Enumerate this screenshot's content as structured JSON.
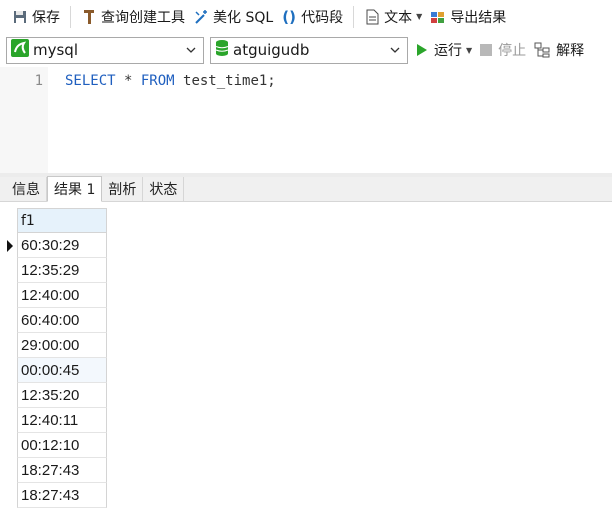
{
  "toolbar": {
    "save": "保存",
    "query_builder": "查询创建工具",
    "beautify": "美化 SQL",
    "snippet": "代码段",
    "text": "文本",
    "export": "导出结果"
  },
  "selectors": {
    "connection": "mysql",
    "database": "atguigudb",
    "run": "运行",
    "stop": "停止",
    "explain": "解释"
  },
  "editor": {
    "line_number": "1",
    "kw_select": "SELECT",
    "star": " * ",
    "kw_from": "FROM",
    "table": " test_time1;"
  },
  "tabs": [
    {
      "label": "信息"
    },
    {
      "label": "结果 1"
    },
    {
      "label": "剖析"
    },
    {
      "label": "状态"
    }
  ],
  "result": {
    "column": "f1",
    "rows": [
      "60:30:29",
      "12:35:29",
      "12:40:00",
      "60:40:00",
      "29:00:00",
      "00:00:45",
      "12:35:20",
      "12:40:11",
      "00:12:10",
      "18:27:43",
      "18:27:43"
    ]
  },
  "colors": {
    "keyword": "#1f5fbf",
    "run_green": "#2aa52a",
    "header_bg": "#e6f2fb",
    "selected_row_bg": "#f3f8fd"
  }
}
